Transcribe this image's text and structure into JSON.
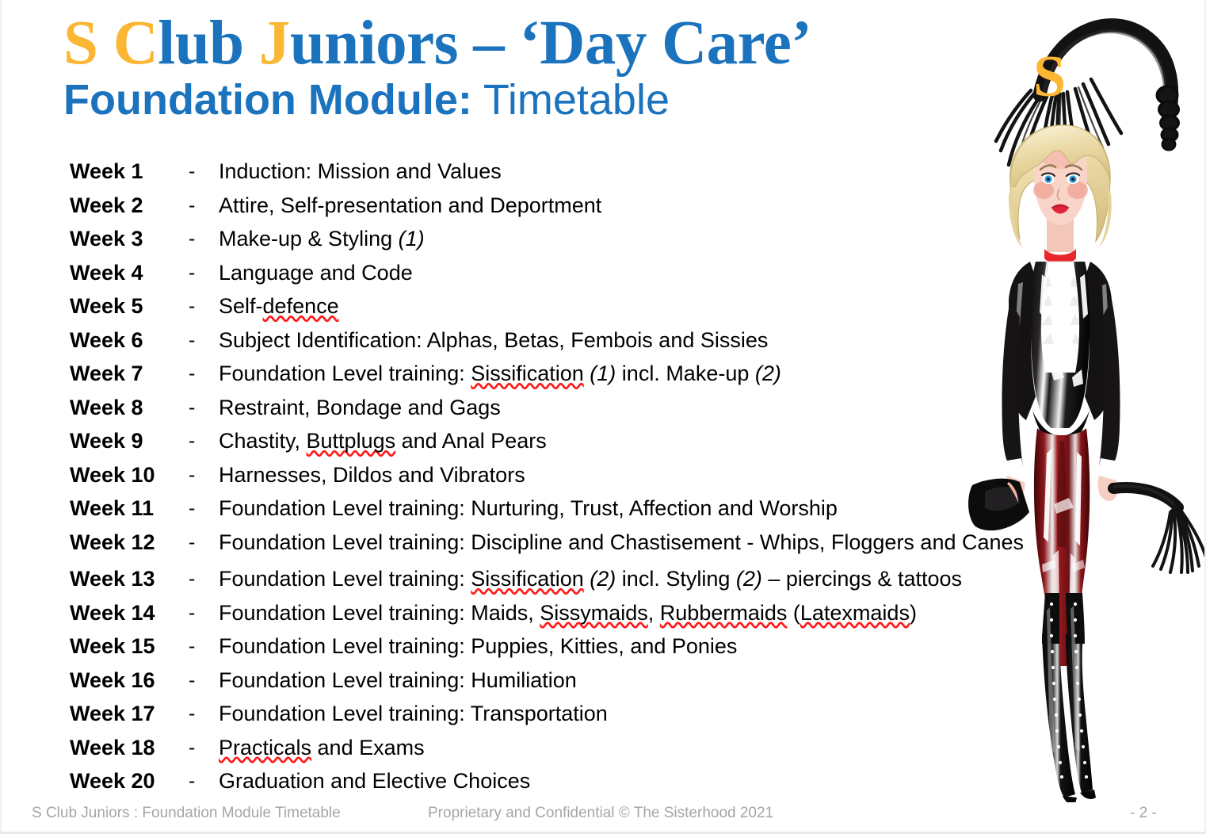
{
  "slide": {
    "page_number": "- 2 -"
  },
  "title": {
    "line1_parts": [
      {
        "text": "S",
        "color": "gold"
      },
      {
        "text": " ",
        "color": "gold"
      },
      {
        "text": "C",
        "color": "gold"
      },
      {
        "text": "lub ",
        "color": "blue"
      },
      {
        "text": "J",
        "color": "gold"
      },
      {
        "text": "uniors – ‘Day Care’",
        "color": "blue"
      }
    ],
    "line1_plain": "S Club Juniors – ‘Day Care’",
    "subtitle_bold": "Foundation Module:",
    "subtitle_normal": " Timetable",
    "colors": {
      "gold": "#FBB734",
      "blue": "#1B73BD"
    }
  },
  "logo": {
    "letter": "S"
  },
  "timetable": {
    "separator": "-",
    "rows": [
      {
        "week": "Week 1",
        "desc_html": "Induction:  Mission and Values"
      },
      {
        "week": "Week 2",
        "desc_html": "Attire, Self-presentation and Deportment"
      },
      {
        "week": "Week 3",
        "desc_html": "Make-up &amp; Styling <i>(1)</i>"
      },
      {
        "week": "Week 4",
        "desc_html": "Language and Code"
      },
      {
        "week": "Week 5",
        "desc_html": "Self-<span class=\"sp\">defence</span>"
      },
      {
        "week": "Week 6",
        "desc_html": "Subject Identification: Alphas, Betas, Fembois and Sissies"
      },
      {
        "week": "Week 7",
        "desc_html": "Foundation Level training: <span class=\"sp\">Sissification</span> <i>(1)</i> incl. Make-up <i>(2)</i>"
      },
      {
        "week": "Week 8",
        "desc_html": "Restraint, Bondage and Gags"
      },
      {
        "week": "Week 9",
        "desc_html": "Chastity, <span class=\"sp\">Buttplugs</span> and Anal Pears"
      },
      {
        "week": "Week 10",
        "desc_html": "Harnesses, Dildos and Vibrators"
      },
      {
        "week": "Week 11",
        "desc_html": "Foundation Level training: Nurturing, Trust, Affection and Worship"
      },
      {
        "week": "Week 12",
        "desc_html": "Foundation Level training: Discipline and Chastisement - Whips, Floggers and Canes"
      },
      {
        "week": "Week 13",
        "desc_html": "Foundation Level training: <span class=\"sp\">Sissification</span> <i>(2)</i> incl. Styling <i>(2)</i> – piercings &amp; tattoos"
      },
      {
        "week": "Week 14",
        "desc_html": "Foundation Level training: Maids, <span class=\"sp\">Sissymaids</span>, <span class=\"sp\">Rubbermaids</span> (<span class=\"sp\">Latexmaids</span>)"
      },
      {
        "week": "Week 15",
        "desc_html": "Foundation Level training: Puppies, Kitties, and Ponies"
      },
      {
        "week": "Week 16",
        "desc_html": "Foundation Level training: Humiliation"
      },
      {
        "week": "Week 17",
        "desc_html": "Foundation Level training: Transportation"
      },
      {
        "week": "Week 18",
        "desc_html": "<span class=\"sp\">Practicals</span> and Exams"
      },
      {
        "week": "Week 20",
        "desc_html": "Graduation and Elective Choices"
      }
    ]
  },
  "footer": {
    "left": "S Club Juniors : Foundation Module Timetable",
    "center": "Proprietary and Confidential © The Sisterhood 2021",
    "right": "- 2 -"
  },
  "artwork": {
    "description": "dominatrix-illustration",
    "top_item": "flogger-whip-photo",
    "figure": {
      "hair_color": "#F2E4B8",
      "choker_color": "#E8262B",
      "jacket_color": "#151214",
      "leggings_color": "#7A1114",
      "boots_color": "#111111",
      "skin_color": "#F6CFC2"
    }
  }
}
